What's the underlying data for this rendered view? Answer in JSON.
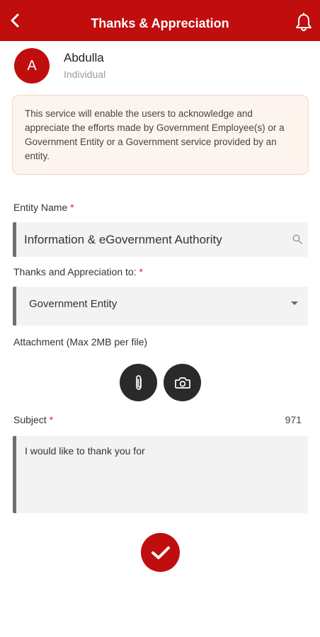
{
  "header": {
    "title": "Thanks & Appreciation",
    "back_icon": "chevron-left-icon",
    "notification_icon": "bell-icon",
    "brand_color": "#c00d0d"
  },
  "user": {
    "initial": "A",
    "name": "Abdulla",
    "type": "Individual"
  },
  "notice": {
    "text": "This service will enable the users to acknowledge and appreciate the efforts made by Government Employee(s) or a Government Entity or a Government service provided by an entity."
  },
  "form": {
    "entity_name_label": "Entity Name",
    "entity_name_value": "Information & eGovernment Authority",
    "appreciation_to_label": "Thanks and Appreciation to:",
    "appreciation_to_value": "Government Entity",
    "attachment_label": "Attachment (Max 2MB per file)",
    "subject_label": "Subject",
    "subject_char_count": "971",
    "subject_value": "I would like to thank you for",
    "required_marker": "*"
  }
}
